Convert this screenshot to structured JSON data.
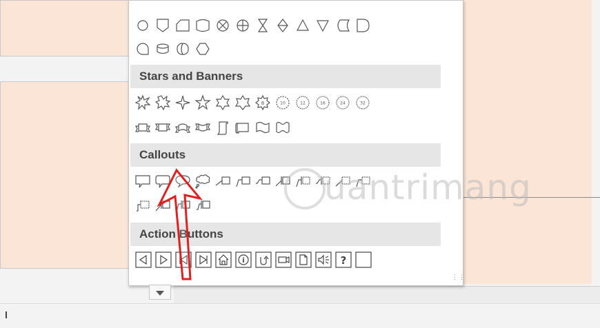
{
  "gallery": {
    "sections": {
      "stars_banners": "Stars and Banners",
      "callouts": "Callouts",
      "action_buttons": "Action Buttons"
    },
    "basic_shapes_row1": [
      "circle",
      "plaque-shield",
      "snip-corner",
      "folded-corner",
      "x-circle",
      "plus-circle",
      "hourglass",
      "diamond-sort",
      "triangle",
      "inverted-triangle",
      "flowchart-stored-data",
      "delay"
    ],
    "basic_shapes_row2": [
      "flowchart-connector",
      "can-cylinder",
      "direct-access-storage",
      "decagon"
    ],
    "stars_row": [
      "explosion-1",
      "explosion-2",
      "star-4",
      "star-5",
      "star-6",
      "star-7",
      "star-8",
      "star-10",
      "star-12",
      "star-16",
      "star-24",
      "star-32"
    ],
    "star_labels": {
      "s8": "8",
      "s10": "10",
      "s12": "12",
      "s16": "16",
      "s24": "24",
      "s32": "32"
    },
    "banners_row": [
      "ribbon-up",
      "ribbon-down",
      "curved-ribbon-up",
      "curved-ribbon-down",
      "vertical-scroll",
      "horizontal-scroll",
      "wave",
      "double-wave"
    ],
    "callouts_row1": [
      "rectangular-callout",
      "rounded-rectangular-callout",
      "oval-callout",
      "cloud-callout",
      "line-callout-1",
      "line-callout-2",
      "line-callout-3",
      "line-callout-1-accent-bar",
      "line-callout-2-accent-bar",
      "line-callout-3-accent-bar",
      "line-callout-1-no-border",
      "line-callout-2-no-border"
    ],
    "callouts_row2": [
      "line-callout-3-no-border",
      "line-callout-1-border-accent",
      "line-callout-2-border-accent",
      "line-callout-3-border-accent"
    ],
    "action_buttons": [
      "back-previous",
      "forward-next",
      "beginning",
      "end",
      "home",
      "information",
      "return",
      "video",
      "document",
      "sound",
      "help",
      "custom"
    ],
    "action_labels": {
      "info": "i",
      "help": "?"
    }
  },
  "watermark": {
    "text": "uantrimang"
  },
  "colors": {
    "slide_bg": "#fbe5d6",
    "arrow": "#e02020",
    "header_bg": "#e6e6e6"
  }
}
